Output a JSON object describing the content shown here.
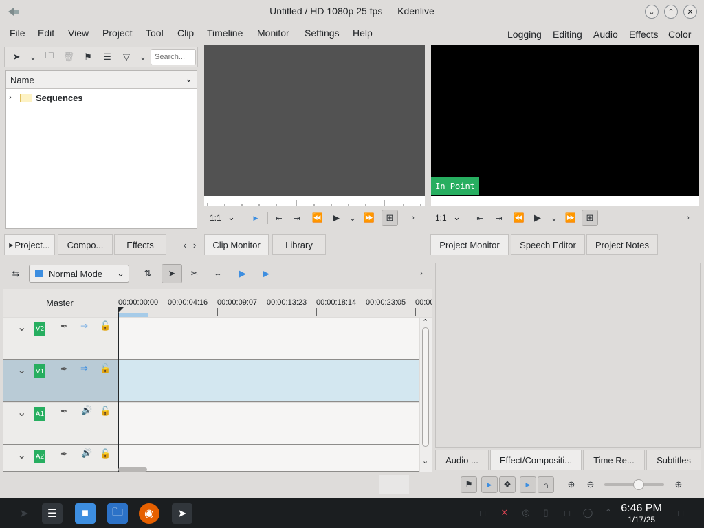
{
  "window": {
    "title": "Untitled / HD 1080p 25 fps — Kdenlive"
  },
  "menu": [
    "File",
    "Edit",
    "View",
    "Project",
    "Tool",
    "Clip",
    "Timeline",
    "Monitor",
    "Settings",
    "Help"
  ],
  "workspaces": [
    "Logging",
    "Editing",
    "Audio",
    "Effects",
    "Color"
  ],
  "bin": {
    "search_placeholder": "Search...",
    "column_header": "Name",
    "folder": "Sequences"
  },
  "left_tabs": [
    "Project...",
    "Compo...",
    "Effects"
  ],
  "clip_monitor": {
    "zoom": "1:1",
    "tabs": [
      "Clip Monitor",
      "Library"
    ]
  },
  "project_monitor": {
    "zoom": "1:1",
    "overlay": "In Point",
    "tabs": [
      "Project Monitor",
      "Speech Editor",
      "Project Notes"
    ]
  },
  "timeline": {
    "mode": "Normal Mode",
    "master_label": "Master",
    "ruler": [
      "00:00:00:00",
      "00:00:04:16",
      "00:00:09:07",
      "00:00:13:23",
      "00:00:18:14",
      "00:00:23:05",
      "00:00"
    ],
    "tracks": [
      "V2",
      "V1",
      "A1",
      "A2"
    ]
  },
  "right_tabs": [
    "Audio ...",
    "Effect/Compositi...",
    "Time Re...",
    "Subtitles"
  ],
  "taskbar": {
    "time": "6:46 PM",
    "date": "1/17/25"
  },
  "colors": {
    "accent_green": "#27ae60",
    "selected_track": "#d3e7f0",
    "monitor_bg": "#000000",
    "clip_monitor_bg": "#525252",
    "taskbar_bg": "#1b1e20"
  }
}
